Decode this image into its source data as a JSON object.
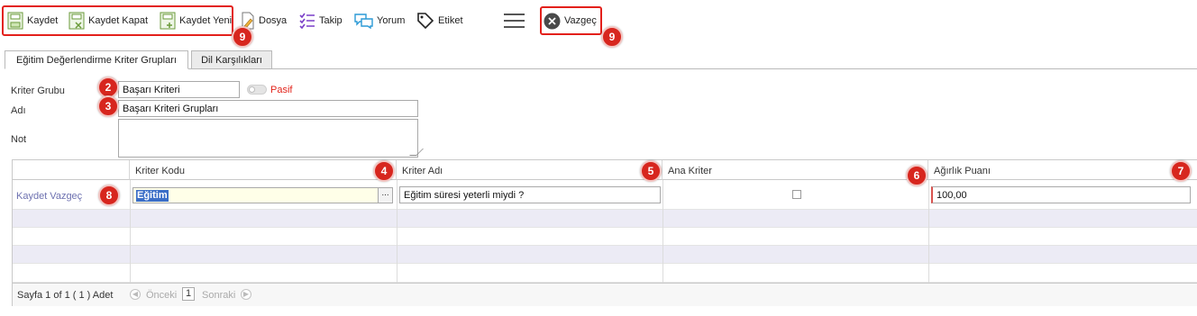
{
  "toolbar": {
    "save": "Kaydet",
    "save_close": "Kaydet Kapat",
    "save_new": "Kaydet Yeni",
    "file": "Dosya",
    "follow": "Takip",
    "comment": "Yorum",
    "tag": "Etiket",
    "cancel": "Vazgeç"
  },
  "tabs": [
    "Eğitim Değerlendirme Kriter Grupları",
    "Dil Karşılıkları"
  ],
  "form": {
    "group_label": "Kriter Grubu",
    "group_value": "Başarı Kriteri",
    "status_label": "Pasif",
    "name_label": "Adı",
    "name_value": "Başarı Kriteri Grupları",
    "note_label": "Not"
  },
  "grid": {
    "columns": [
      "Kriter Kodu",
      "Kriter Adı",
      "Ana Kriter",
      "Ağırlık Puanı"
    ],
    "edit_row": {
      "actions": "Kaydet Vazgeç",
      "code": "Eğitim",
      "name": "Eğitim süresi yeterli miydi ?",
      "main_criterion": false,
      "weight": "100,00"
    },
    "pager": {
      "summary": "Sayfa 1 of 1 ( 1 ) Adet",
      "prev": "Önceki",
      "page": "1",
      "next": "Sonraki"
    }
  },
  "markers": [
    "2",
    "3",
    "4",
    "5",
    "6",
    "7",
    "8",
    "9",
    "9"
  ],
  "colors": {
    "marker": "#d7261e",
    "highlight_box": "#e3201b",
    "status_red": "#e2231a",
    "alt_row": "#ecebf5"
  }
}
